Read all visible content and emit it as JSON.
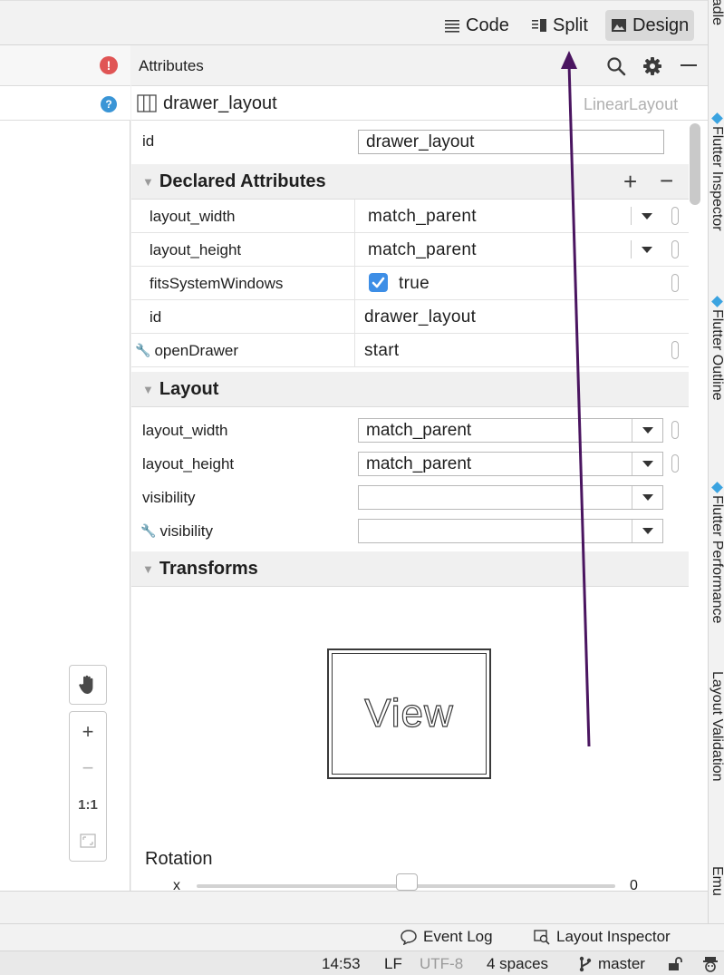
{
  "toolbar": {
    "modes": [
      {
        "label": "Code",
        "icon": "code-lines-icon"
      },
      {
        "label": "Split",
        "icon": "split-view-icon"
      },
      {
        "label": "Design",
        "icon": "image-icon",
        "active": true
      }
    ]
  },
  "attributes_panel": {
    "title": "Attributes",
    "component": {
      "name": "drawer_layout",
      "type": "LinearLayout"
    },
    "id_row": {
      "label": "id",
      "value": "drawer_layout"
    },
    "declared": {
      "title": "Declared Attributes",
      "rows": [
        {
          "label": "layout_width",
          "value": "match_parent"
        },
        {
          "label": "layout_height",
          "value": "match_parent"
        },
        {
          "label": "fitsSystemWindows",
          "value": "true",
          "checked": true
        },
        {
          "label": "id",
          "value": "drawer_layout"
        },
        {
          "label": "openDrawer",
          "value": "start"
        }
      ]
    },
    "layout": {
      "title": "Layout",
      "rows": [
        {
          "label": "layout_width",
          "value": "match_parent"
        },
        {
          "label": "layout_height",
          "value": "match_parent"
        },
        {
          "label": "visibility",
          "value": ""
        },
        {
          "label": "visibility",
          "value": ""
        }
      ]
    },
    "transforms": {
      "title": "Transforms",
      "preview_label": "View",
      "rotation_label": "Rotation",
      "rotation_axis": "x",
      "rotation_value": "0"
    }
  },
  "zoom_tools": {
    "fit_label": "1:1"
  },
  "right_strip": {
    "tabs": [
      "Gradle",
      "Flutter Inspector",
      "Flutter Outline",
      "Flutter Performance",
      "Layout Validation",
      "Emu"
    ]
  },
  "bottom_tabs": {
    "event_log": "Event Log",
    "layout_inspector": "Layout Inspector"
  },
  "status_bar": {
    "position": "14:53",
    "line_separator": "LF",
    "encoding": "UTF-8",
    "indent": "4 spaces",
    "branch": "master"
  },
  "colors": {
    "error_icon": "#e05555",
    "help_icon": "#3a95d6",
    "checkbox": "#3d8ee6",
    "annotation_arrow": "#4a1560"
  }
}
